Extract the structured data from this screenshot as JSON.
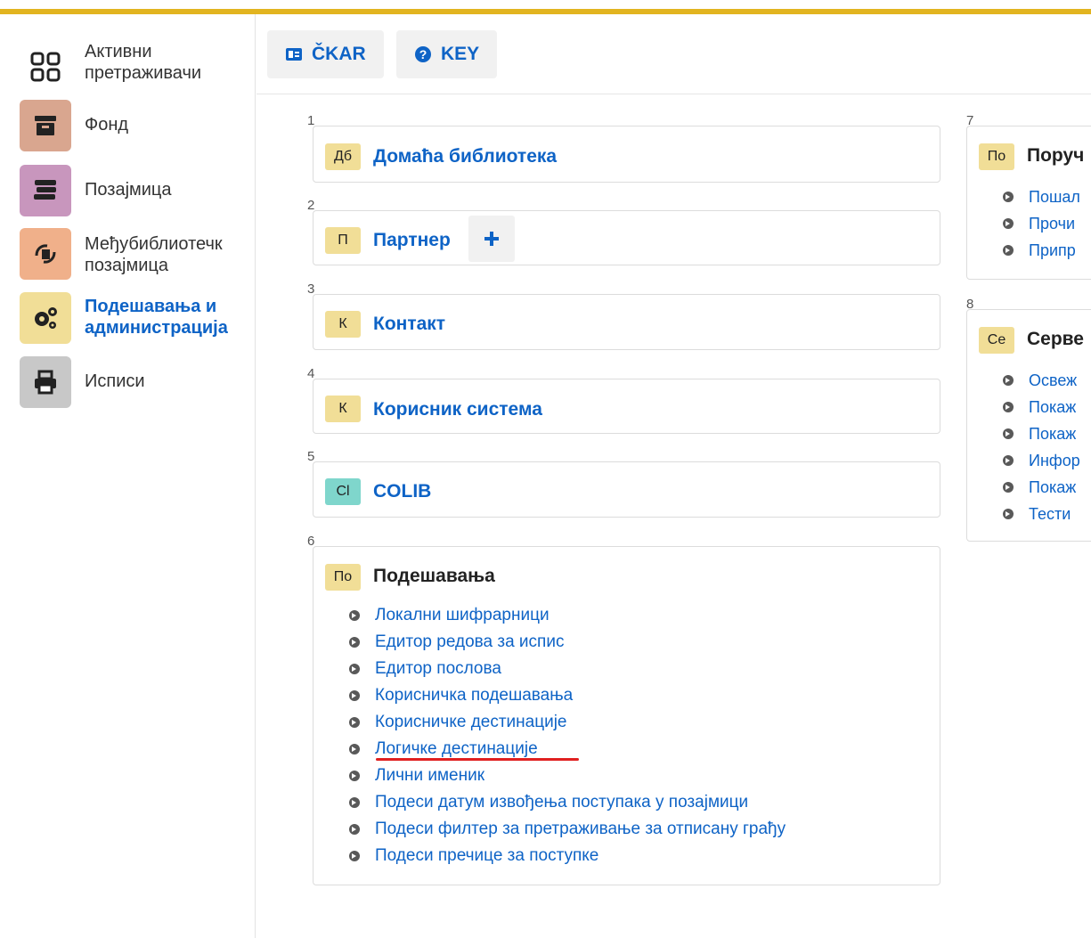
{
  "sidebar": {
    "items": [
      {
        "label_line1": "Активни",
        "label_line2": "претраживачи",
        "icon": "grid-icon"
      },
      {
        "label": "Фонд",
        "icon": "archive-icon",
        "color": "#d9a68f"
      },
      {
        "label": "Позајмица",
        "icon": "books-icon",
        "color": "#c896bd"
      },
      {
        "label_line1": "Међубиблиотечк",
        "label_line2": "позајмица",
        "icon": "exchange-icon",
        "color": "#f0b08a"
      },
      {
        "label_line1": "Подешавања и",
        "label_line2": "администрација",
        "icon": "gears-icon",
        "color": "#f1de97",
        "active": true
      },
      {
        "label": "Исписи",
        "icon": "printer-icon",
        "color": "#c8c8c8"
      }
    ]
  },
  "toolbar": {
    "ckar_label": "ČKAR",
    "key_label": "KEY"
  },
  "panels": [
    {
      "num": "1",
      "badge": "Дб",
      "title": "Домаћа библиотека"
    },
    {
      "num": "2",
      "badge": "П",
      "title": "Партнер"
    },
    {
      "num": "3",
      "badge": "К",
      "title": "Контакт"
    },
    {
      "num": "4",
      "badge": "К",
      "title": "Корисник система"
    },
    {
      "num": "5",
      "badge": "Cl",
      "title": "COLIB"
    },
    {
      "num": "6",
      "badge": "По",
      "title": "Подешавања",
      "links": [
        "Локални шифрарници",
        "Едитор редова за испис",
        "Едитор послова",
        "Корисничка подешавања",
        "Корисничке дестинације",
        "Логичке дестинације",
        "Лични именик",
        "Подеси датум извођења поступака у позајмици",
        "Подеси филтер за претраживање за отписану грађу",
        "Подеси пречице за поступке"
      ]
    },
    {
      "num": "7",
      "badge": "По",
      "title": "Поруч",
      "links": [
        "Пошал",
        "Прочи",
        "Припр"
      ]
    },
    {
      "num": "8",
      "badge": "Се",
      "title": "Серве",
      "links": [
        "Освеж",
        "Покаж",
        "Покаж",
        "Инфор",
        "Покаж",
        "Тести"
      ]
    }
  ],
  "colors": {
    "accent": "#0e63c6",
    "top_bar": "#e2b420",
    "underline": "#e02020"
  }
}
